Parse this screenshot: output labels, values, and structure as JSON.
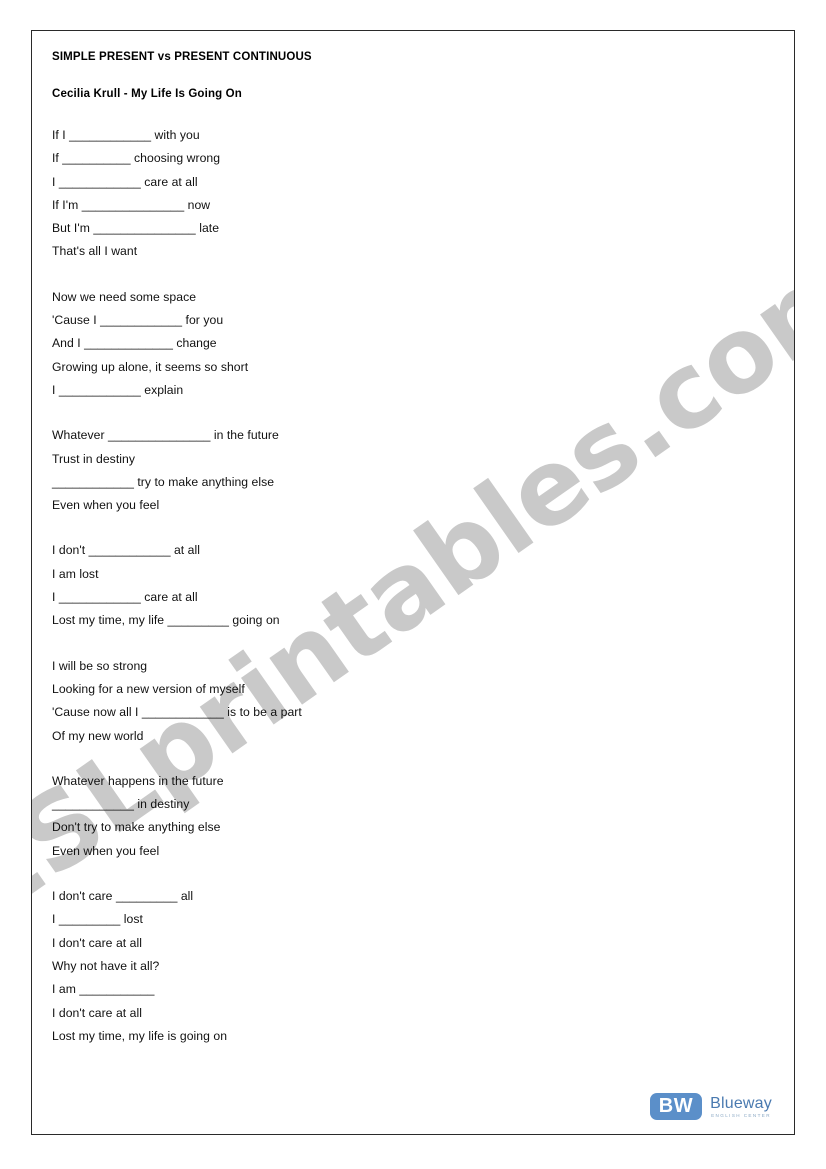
{
  "page": {
    "watermark": "ESLprintables.com"
  },
  "header": {
    "doc_title": "SIMPLE PRESENT vs PRESENT CONTINUOUS",
    "song_title": "Cecilia Krull - My Life Is Going On"
  },
  "lyrics": {
    "verses": [
      {
        "lines": [
          "If I ____________ with you",
          "If __________ choosing wrong",
          "I ____________ care at all",
          "If I'm _______________ now",
          "But I'm _______________ late",
          "That's all I want"
        ]
      },
      {
        "lines": [
          "Now we need some space",
          "'Cause I ____________ for you",
          "And I _____________ change",
          "Growing up alone, it seems so short",
          "I ____________ explain"
        ]
      },
      {
        "lines": [
          "Whatever _______________ in the future",
          "Trust in destiny",
          "____________ try to make anything else",
          "Even when you feel"
        ]
      },
      {
        "lines": [
          "I don't ____________ at all",
          "I am lost",
          "I ____________ care at all",
          "Lost my time, my life _________ going on"
        ]
      },
      {
        "lines": [
          "I will be so strong",
          "Looking for a new version of myself",
          "'Cause now all I ____________ is to be a part",
          "Of my new world"
        ]
      },
      {
        "lines": [
          "Whatever happens in the future",
          "____________ in destiny",
          "Don't try to make anything else",
          "Even when you feel"
        ]
      },
      {
        "lines": [
          "I don't care _________ all",
          "I _________ lost",
          "I don't care at all",
          "Why not have it all?",
          "I am ___________",
          "I don't care at all",
          "Lost my time, my life is going on"
        ]
      }
    ]
  },
  "logo": {
    "badge": "BW",
    "wordmark": "Blueway",
    "sub": "ENGLISH CENTER",
    "badge_color": "#5b8fc9",
    "word_color": "#4a7ab0"
  }
}
